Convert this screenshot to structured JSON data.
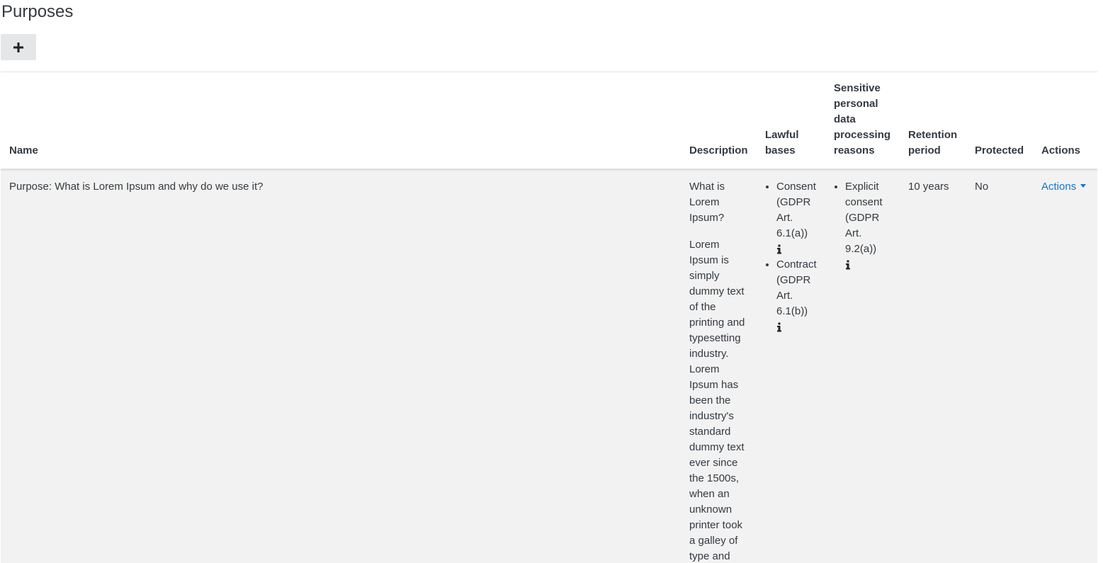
{
  "page": {
    "title": "Purposes",
    "add_button_icon": "plus-icon"
  },
  "table": {
    "columns": {
      "name": "Name",
      "description": "Description",
      "lawful_bases": "Lawful bases",
      "sensitive": "Sensitive personal data processing reasons",
      "retention": "Retention period",
      "protected": "Protected",
      "actions": "Actions"
    },
    "rows": [
      {
        "name": "Purpose: What is Lorem Ipsum and why do we use it?",
        "description_heading": "What is Lorem Ipsum?",
        "description_body": "Lorem Ipsum is simply dummy text of the printing and typesetting industry. Lorem Ipsum has been the industry's standard dummy text ever since the 1500s, when an unknown printer took a galley of type and",
        "lawful_bases": [
          {
            "label": "Consent (GDPR Art. 6.1(a))",
            "icon": "info-icon"
          },
          {
            "label": "Contract (GDPR Art. 6.1(b))",
            "icon": "info-icon"
          }
        ],
        "sensitive_reasons": [
          {
            "label": "Explicit consent (GDPR Art. 9.2(a))",
            "icon": "info-icon"
          }
        ],
        "retention": "10 years",
        "protected": "No",
        "actions_label": "Actions"
      }
    ]
  },
  "colors": {
    "link": "#1177d1",
    "row_bg": "#f2f2f2",
    "button_bg": "#e4e6e8"
  }
}
